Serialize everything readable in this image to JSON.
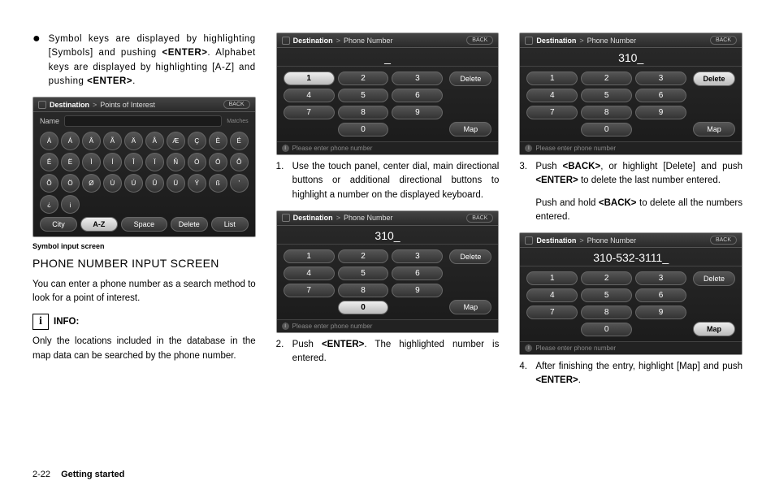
{
  "footer": {
    "page": "2-22",
    "section": "Getting started"
  },
  "col1": {
    "bullet": {
      "pre": "Symbol keys are displayed by highlighting [Symbols] and pushing ",
      "enter1": "<ENTER>",
      "mid": ". Alphabet keys are displayed by highlighting [A-Z] and pushing ",
      "enter2": "<ENTER>",
      "post": "."
    },
    "caption": "Symbol input screen",
    "section": "PHONE NUMBER INPUT SCREEN",
    "p1": "You can enter a phone number as a search method to look for a point of interest.",
    "info_label": "INFO:",
    "p2": "Only the locations included in the database in the map data can be searched by the phone number.",
    "screen_sym": {
      "bc_a": "Destination",
      "bc_b": "Points of Interest",
      "back": "BACK",
      "name_label": "Name",
      "matches": "Matches",
      "row1": [
        "À",
        "Á",
        "Â",
        "Ã",
        "Ä",
        "Å",
        "Æ",
        "Ç",
        "È",
        "É"
      ],
      "row2": [
        "Ê",
        "Ë",
        "Ì",
        "Í",
        "Î",
        "Ï",
        "Ñ",
        "Ò",
        "Ó",
        "Ô"
      ],
      "row3": [
        "Õ",
        "Ö",
        "Ø",
        "Ù",
        "Ú",
        "Û",
        "Ü",
        "Ý",
        "ß",
        "’"
      ],
      "row4": [
        "¿",
        "¡",
        "",
        "",
        "",
        "",
        "",
        "",
        "",
        ""
      ],
      "bottom": {
        "city": "City",
        "az": "A-Z",
        "space": "Space",
        "delete": "Delete",
        "list": "List"
      }
    }
  },
  "col2": {
    "screen_a": {
      "bc_a": "Destination",
      "bc_b": "Phone Number",
      "back": "BACK",
      "display": "_",
      "delete": "Delete",
      "map": "Map",
      "hint": "Please enter phone number"
    },
    "step1": "Use the touch panel, center dial, main directional buttons or additional directional buttons to highlight a number on the displayed keyboard.",
    "screen_b": {
      "bc_a": "Destination",
      "bc_b": "Phone Number",
      "back": "BACK",
      "display": "310_",
      "delete": "Delete",
      "map": "Map",
      "hint": "Please enter phone number"
    },
    "step2_pre": "Push ",
    "step2_enter": "<ENTER>",
    "step2_post": ". The highlighted number is entered."
  },
  "col3": {
    "screen_a": {
      "bc_a": "Destination",
      "bc_b": "Phone Number",
      "back": "BACK",
      "display": "310_",
      "delete": "Delete",
      "map": "Map",
      "hint": "Please enter phone number"
    },
    "step3_a_pre": "Push ",
    "step3_a_back": "<BACK>",
    "step3_a_mid": ", or highlight [Delete] and push ",
    "step3_a_enter": "<ENTER>",
    "step3_a_post": " to delete the last number entered.",
    "step3_b_pre": "Push and hold ",
    "step3_b_back": "<BACK>",
    "step3_b_post": " to delete all the numbers entered.",
    "screen_b": {
      "bc_a": "Destination",
      "bc_b": "Phone Number",
      "back": "BACK",
      "display": "310-532-3111_",
      "delete": "Delete",
      "map": "Map",
      "hint": "Please enter phone number"
    },
    "step4_pre": "After finishing the entry, highlight [Map] and push ",
    "step4_enter": "<ENTER>",
    "step4_post": "."
  },
  "keypad": [
    "1",
    "2",
    "3",
    "4",
    "5",
    "6",
    "7",
    "8",
    "9",
    "0"
  ]
}
